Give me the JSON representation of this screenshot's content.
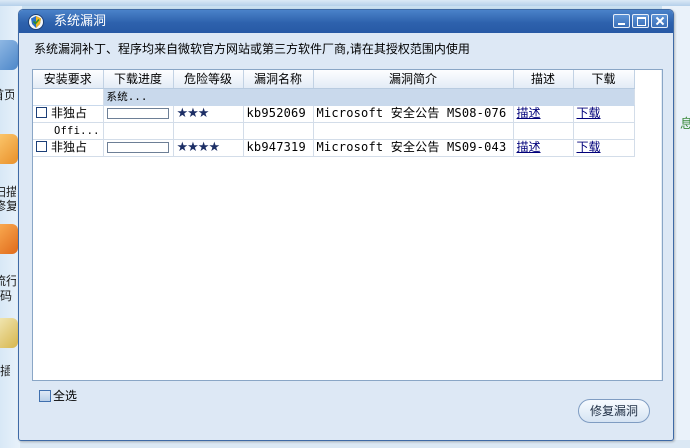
{
  "background": {
    "sidebar_items": [
      "首页",
      "扫描",
      "修复",
      "流行",
      "码",
      "捷插"
    ],
    "right_edge_char": "息"
  },
  "dialog": {
    "title": "系统漏洞",
    "notice": "系统漏洞补丁、程序均来自微软官方网站或第三方软件厂商,请在其授权范围内使用",
    "columns": [
      "安装要求",
      "下载进度",
      "危险等级",
      "漏洞名称",
      "漏洞简介",
      "描述",
      "下载"
    ],
    "groups": [
      {
        "group_label": "系统...",
        "rows": [
          {
            "requirement": "非独占",
            "progress": 0,
            "risk_stars": "★★★",
            "risk_level": 3,
            "name": "kb952069",
            "summary": "Microsoft 安全公告 MS08-076 ...",
            "describe_link": "描述",
            "download_link": "下载"
          }
        ]
      },
      {
        "group_label": "Offi...",
        "rows": [
          {
            "requirement": "非独占",
            "progress": 0,
            "risk_stars": "★★★★",
            "risk_level": 4,
            "name": "kb947319",
            "summary": "Microsoft 安全公告 MS09-043 -...",
            "describe_link": "描述",
            "download_link": "下载"
          }
        ]
      }
    ],
    "select_all_label": "全选",
    "fix_button_label": "修复漏洞"
  },
  "colors": {
    "titlebar": "#2e62ad",
    "group_row": "#c9d9ec",
    "link": "#00007a"
  }
}
